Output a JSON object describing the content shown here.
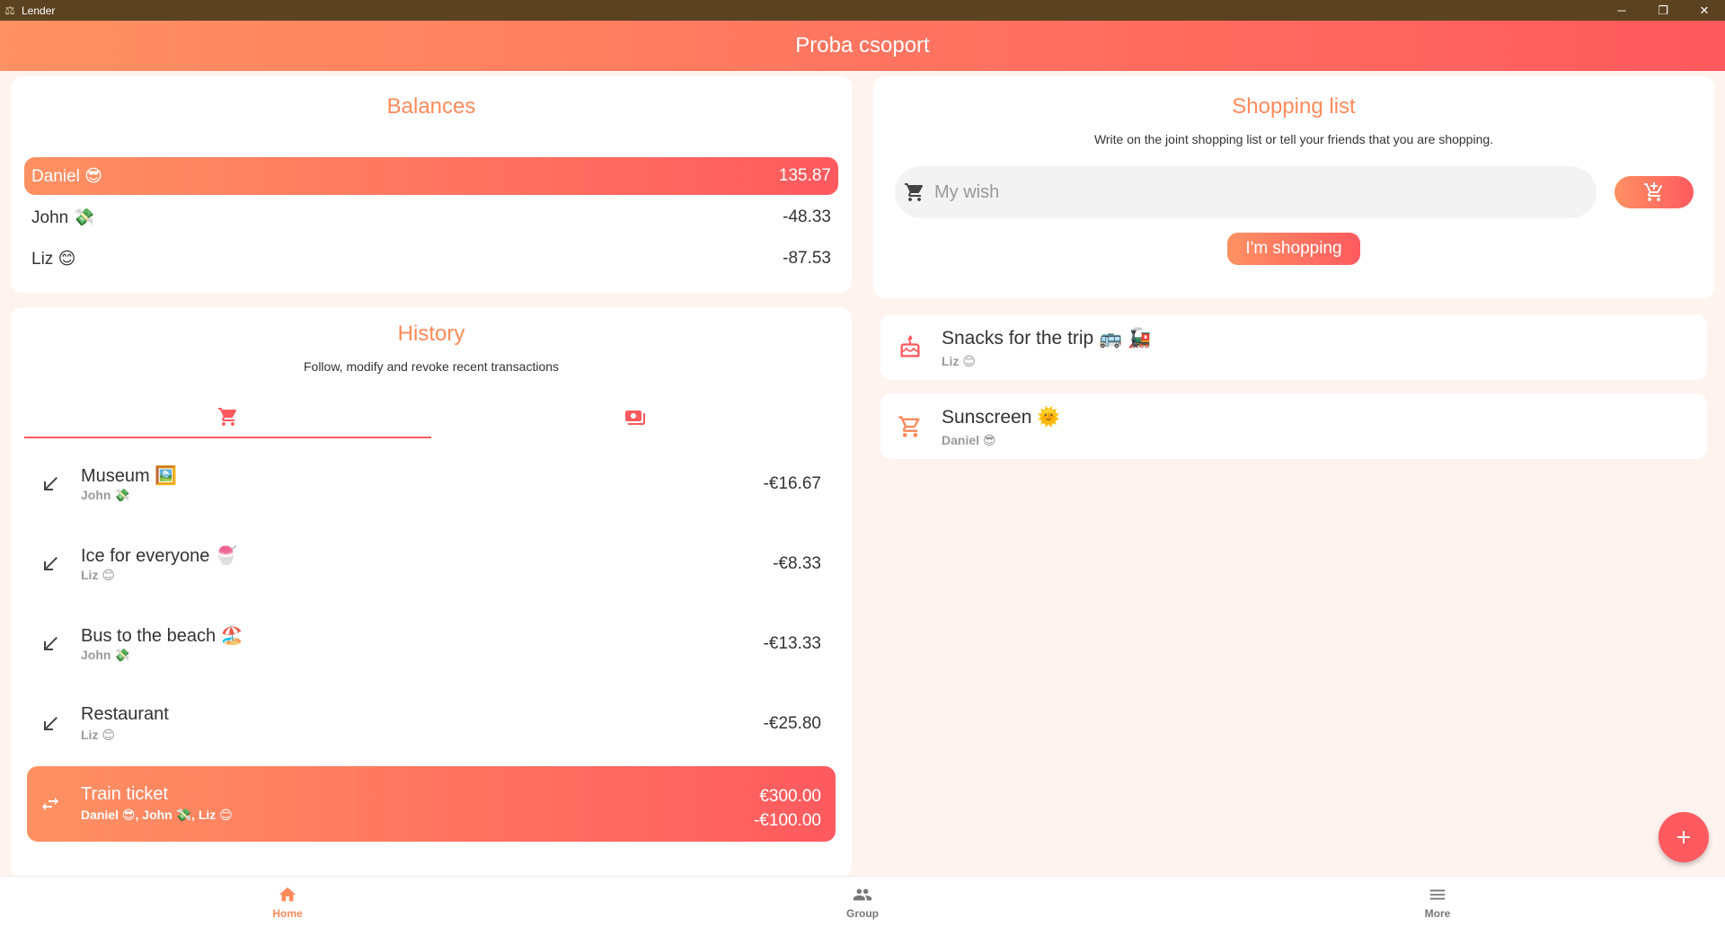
{
  "window": {
    "title": "Lender"
  },
  "appbar": {
    "title": "Proba csoport"
  },
  "balances": {
    "title": "Balances",
    "rows": [
      {
        "name": "Daniel 😎",
        "amount": "135.87"
      },
      {
        "name": "John 💸",
        "amount": "-48.33"
      },
      {
        "name": "Liz 😊",
        "amount": "-87.53"
      }
    ]
  },
  "history": {
    "title": "History",
    "subtitle": "Follow, modify and revoke recent transactions",
    "tabs": [
      "purchases-icon",
      "payments-icon"
    ],
    "transactions": [
      {
        "title": "Museum 🖼️",
        "people": "John 💸",
        "amount": "-€16.67"
      },
      {
        "title": "Ice for everyone 🍧",
        "people": "Liz 😊",
        "amount": "-€8.33"
      },
      {
        "title": "Bus to the beach 🏖️",
        "people": "John 💸",
        "amount": "-€13.33"
      },
      {
        "title": "Restaurant",
        "people": "Liz 😊",
        "amount": "-€25.80"
      },
      {
        "title": "Train ticket",
        "people": "Daniel 😎, John 💸, Liz 😊",
        "amount": "€300.00",
        "amount2": "-€100.00"
      }
    ]
  },
  "shopping": {
    "title": "Shopping list",
    "subtitle": "Write on the joint shopping list or tell your friends that you are shopping.",
    "placeholder": "My wish",
    "shopping_button": "I'm shopping",
    "items": [
      {
        "title": "Snacks for the trip 🚌 🚂",
        "author": "Liz 😊"
      },
      {
        "title": "Sunscreen 🌞",
        "author": "Daniel 😎"
      }
    ]
  },
  "nav": {
    "home": "Home",
    "group": "Group",
    "more": "More"
  },
  "colors": {
    "accent": "#ff8a5b",
    "accent_end": "#ff5a5f"
  }
}
